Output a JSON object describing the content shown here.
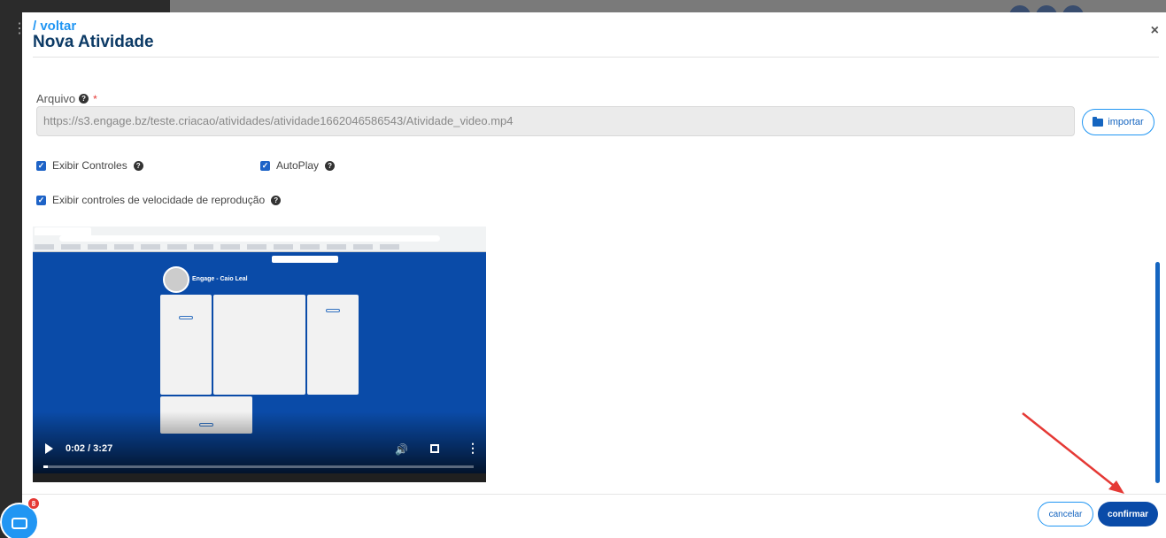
{
  "modal": {
    "back_label": "/ voltar",
    "title": "Nova Atividade",
    "close_glyph": "×"
  },
  "arquivo": {
    "label": "Arquivo",
    "required_mark": "*",
    "value": "https://s3.engage.bz/teste.criacao/atividades/atividade1662046586543/Atividade_video.mp4",
    "import_label": "importar",
    "import_icon": "folder-open-icon"
  },
  "options": {
    "exibir_controles": {
      "label": "Exibir Controles",
      "checked": true
    },
    "autoplay": {
      "label": "AutoPlay",
      "checked": true
    },
    "velocidade": {
      "label": "Exibir controles de velocidade de reprodução",
      "checked": true
    }
  },
  "video": {
    "time": "0:02 / 3:27",
    "progress": 0.01,
    "preview_name": "Engage - Caio Leal"
  },
  "footer": {
    "cancel_label": "cancelar",
    "confirm_label": "confirmar"
  },
  "chat": {
    "badge_count": "8"
  },
  "colors": {
    "primary": "#0a4ba8",
    "accent": "#2196f3",
    "title": "#0d3b66",
    "annotation_arrow": "#e53935"
  }
}
